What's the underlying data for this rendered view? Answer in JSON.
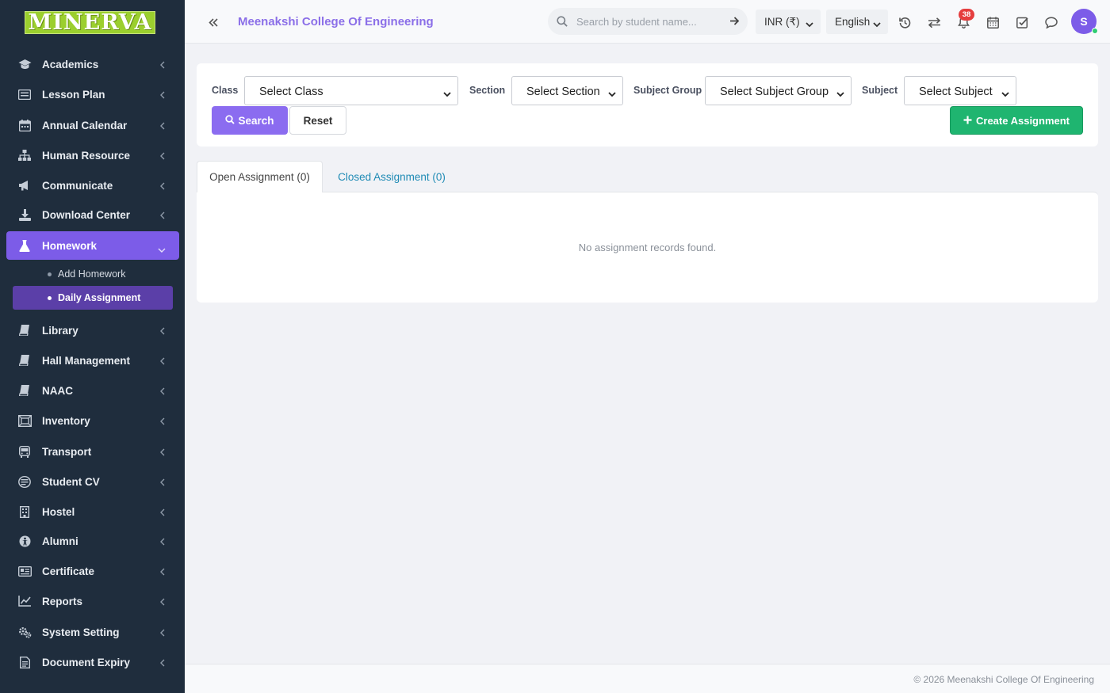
{
  "logo": {
    "text": "MINERVA"
  },
  "sidebar": {
    "items": [
      {
        "label": "Academics",
        "icon": "graduation-cap-icon"
      },
      {
        "label": "Lesson Plan",
        "icon": "lesson-plan-icon"
      },
      {
        "label": "Annual Calendar",
        "icon": "calendar-icon"
      },
      {
        "label": "Human Resource",
        "icon": "sitemap-icon"
      },
      {
        "label": "Communicate",
        "icon": "megaphone-icon"
      },
      {
        "label": "Download Center",
        "icon": "download-icon"
      },
      {
        "label": "Homework",
        "icon": "flask-icon"
      },
      {
        "label": "Library",
        "icon": "book-icon"
      },
      {
        "label": "Hall Management",
        "icon": "book-icon"
      },
      {
        "label": "NAAC",
        "icon": "book-icon"
      },
      {
        "label": "Inventory",
        "icon": "inventory-icon"
      },
      {
        "label": "Transport",
        "icon": "bus-icon"
      },
      {
        "label": "Student CV",
        "icon": "cv-icon"
      },
      {
        "label": "Hostel",
        "icon": "building-icon"
      },
      {
        "label": "Alumni",
        "icon": "alumni-icon"
      },
      {
        "label": "Certificate",
        "icon": "certificate-icon"
      },
      {
        "label": "Reports",
        "icon": "line-chart-icon"
      },
      {
        "label": "System Setting",
        "icon": "gears-icon"
      },
      {
        "label": "Document Expiry",
        "icon": "document-icon"
      }
    ],
    "homework_sub": [
      {
        "label": "Add Homework"
      },
      {
        "label": "Daily Assignment"
      }
    ]
  },
  "header": {
    "college": "Meenakshi College Of Engineering",
    "search_placeholder": "Search by student name...",
    "currency": "INR (₹)",
    "language": "English",
    "notification_count": "38",
    "avatar_initial": "S"
  },
  "filter": {
    "class_label": "Class",
    "class_value": "Select Class",
    "section_label": "Section",
    "section_value": "Select Section",
    "subject_group_label": "Subject Group",
    "subject_group_value": "Select Subject Group",
    "subject_label": "Subject",
    "subject_value": "Select Subject",
    "search_button": "Search",
    "reset_button": "Reset",
    "create_button": "Create Assignment"
  },
  "tabs": {
    "open": "Open Assignment (0)",
    "closed": "Closed Assignment (0)"
  },
  "results": {
    "empty_message": "No assignment records found."
  },
  "footer": {
    "copyright": "© 2026 Meenakshi College Of Engineering"
  },
  "colors": {
    "accent": "#7c5ce8",
    "sidebar": "#1f2d3d",
    "create": "#1fb570",
    "badge": "#e53e3e"
  }
}
